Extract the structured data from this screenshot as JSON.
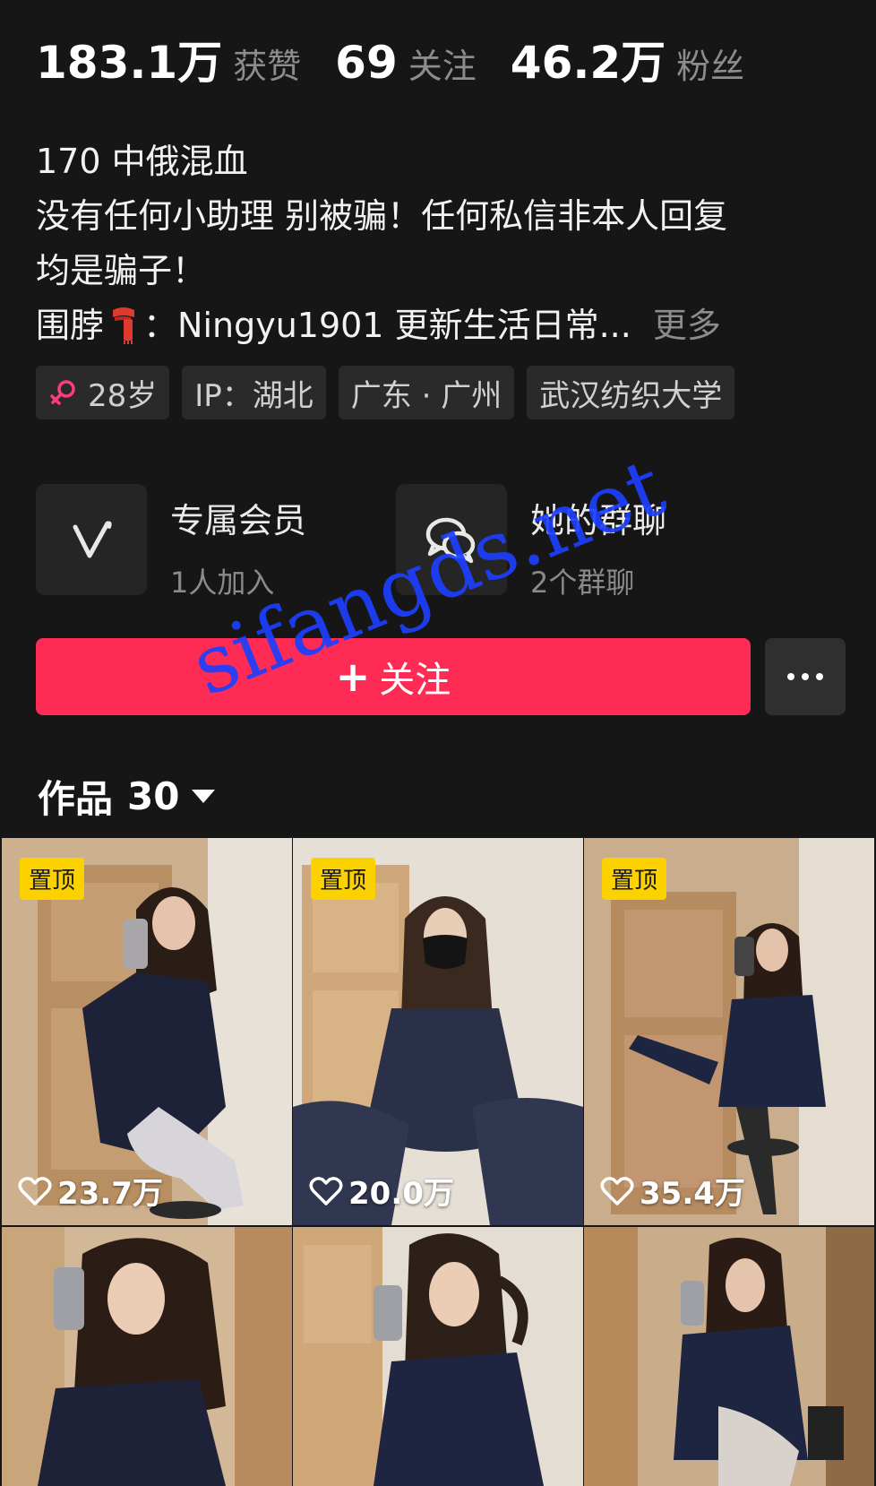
{
  "stats": [
    {
      "value": "183.1万",
      "label": "获赞"
    },
    {
      "value": "69",
      "label": "关注"
    },
    {
      "value": "46.2万",
      "label": "粉丝"
    }
  ],
  "bio": {
    "line1": "170 中俄混血",
    "line2": "没有任何小助理 别被骗！任何私信非本人回复",
    "line3": "均是骗子！",
    "line4_prefix": "围脖",
    "line4_suffix": "：Ningyu1901  更新生活日常...",
    "more": "更多"
  },
  "tags": {
    "age": "28岁",
    "ip": "IP：湖北",
    "location": "广东 · 广州",
    "school": "武汉纺织大学"
  },
  "cards": {
    "member": {
      "title": "专属会员",
      "sub": "1人加入"
    },
    "group": {
      "title": "她的群聊",
      "sub": "2个群聊"
    }
  },
  "follow_button": {
    "plus": "+",
    "label": "关注"
  },
  "works": {
    "label": "作品",
    "count": "30"
  },
  "videos": [
    {
      "pinned": "置顶",
      "likes": "23.7万"
    },
    {
      "pinned": "置顶",
      "likes": "20.0万"
    },
    {
      "pinned": "置顶",
      "likes": "35.4万"
    },
    {
      "pinned": "",
      "likes": ""
    },
    {
      "pinned": "",
      "likes": ""
    },
    {
      "pinned": "",
      "likes": ""
    }
  ],
  "watermark": "sifangds.net",
  "colors": {
    "background": "#161616",
    "follow": "#fe2c55",
    "pin": "#fbd100",
    "watermark": "#1c3fff",
    "gender": "#ff3c7a"
  }
}
